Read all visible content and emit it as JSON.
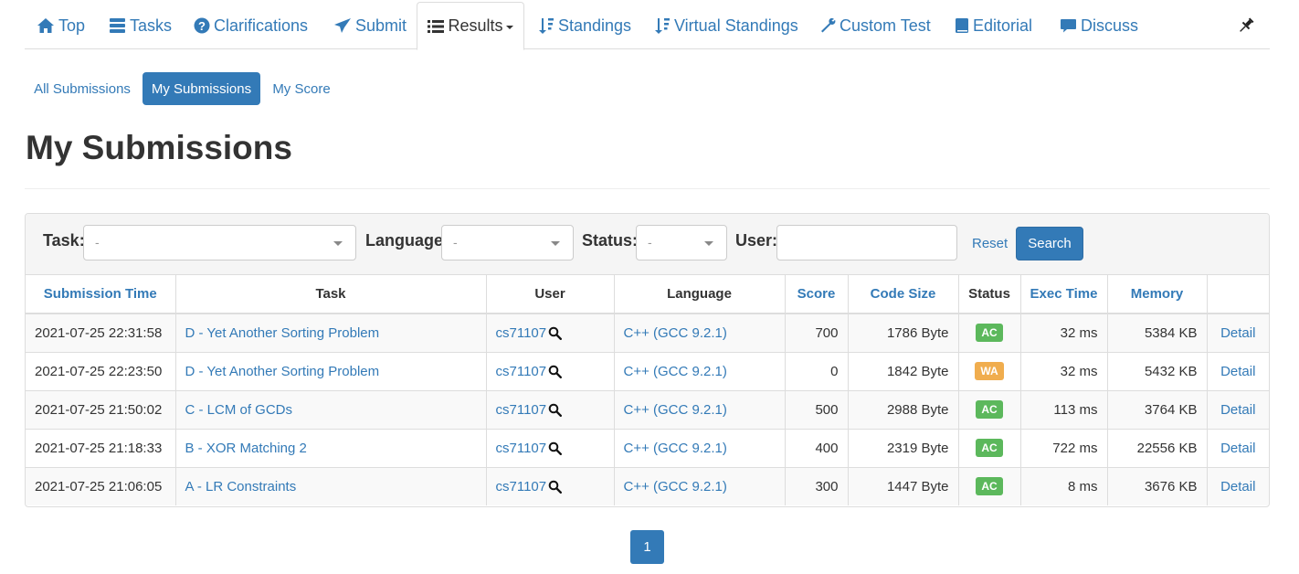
{
  "nav": {
    "items": [
      {
        "label": "Top",
        "icon": "home-icon"
      },
      {
        "label": "Tasks",
        "icon": "tasks-icon"
      },
      {
        "label": "Clarifications",
        "icon": "question-circle-icon"
      },
      {
        "label": "Submit",
        "icon": "send-icon"
      },
      {
        "label": "Results",
        "icon": "list-icon"
      },
      {
        "label": "Standings",
        "icon": "sort-icon"
      },
      {
        "label": "Virtual Standings",
        "icon": "sort-icon"
      },
      {
        "label": "Custom Test",
        "icon": "wrench-icon"
      },
      {
        "label": "Editorial",
        "icon": "book-icon"
      },
      {
        "label": "Discuss",
        "icon": "comment-icon"
      }
    ],
    "pin_icon": "pushpin-icon"
  },
  "pills": [
    "All Submissions",
    "My Submissions",
    "My Score"
  ],
  "title": "My Submissions",
  "filter": {
    "task_label": "Task:",
    "task_value": "-",
    "language_label": "Language:",
    "language_value": "-",
    "status_label": "Status:",
    "status_value": "-",
    "user_label": "User:",
    "user_value": "",
    "reset": "Reset",
    "search": "Search"
  },
  "table": {
    "headers": [
      "Submission Time",
      "Task",
      "User",
      "Language",
      "Score",
      "Code Size",
      "Status",
      "Exec Time",
      "Memory",
      ""
    ],
    "rows": [
      {
        "time": "2021-07-25 22:31:58",
        "task": "D - Yet Another Sorting Problem",
        "user": "cs71107",
        "lang": "C++ (GCC 9.2.1)",
        "score": "700",
        "size": "1786 Byte",
        "status": "AC",
        "exec": "32 ms",
        "mem": "5384 KB",
        "detail": "Detail"
      },
      {
        "time": "2021-07-25 22:23:50",
        "task": "D - Yet Another Sorting Problem",
        "user": "cs71107",
        "lang": "C++ (GCC 9.2.1)",
        "score": "0",
        "size": "1842 Byte",
        "status": "WA",
        "exec": "32 ms",
        "mem": "5432 KB",
        "detail": "Detail"
      },
      {
        "time": "2021-07-25 21:50:02",
        "task": "C - LCM of GCDs",
        "user": "cs71107",
        "lang": "C++ (GCC 9.2.1)",
        "score": "500",
        "size": "2988 Byte",
        "status": "AC",
        "exec": "113 ms",
        "mem": "3764 KB",
        "detail": "Detail"
      },
      {
        "time": "2021-07-25 21:18:33",
        "task": "B - XOR Matching 2",
        "user": "cs71107",
        "lang": "C++ (GCC 9.2.1)",
        "score": "400",
        "size": "2319 Byte",
        "status": "AC",
        "exec": "722 ms",
        "mem": "22556 KB",
        "detail": "Detail"
      },
      {
        "time": "2021-07-25 21:06:05",
        "task": "A - LR Constraints",
        "user": "cs71107",
        "lang": "C++ (GCC 9.2.1)",
        "score": "300",
        "size": "1447 Byte",
        "status": "AC",
        "exec": "8 ms",
        "mem": "3676 KB",
        "detail": "Detail"
      }
    ]
  },
  "pagination": {
    "current": "1"
  },
  "colors": {
    "link": "#337ab7",
    "ac": "#5cb85c",
    "wa": "#f0ad4e"
  }
}
